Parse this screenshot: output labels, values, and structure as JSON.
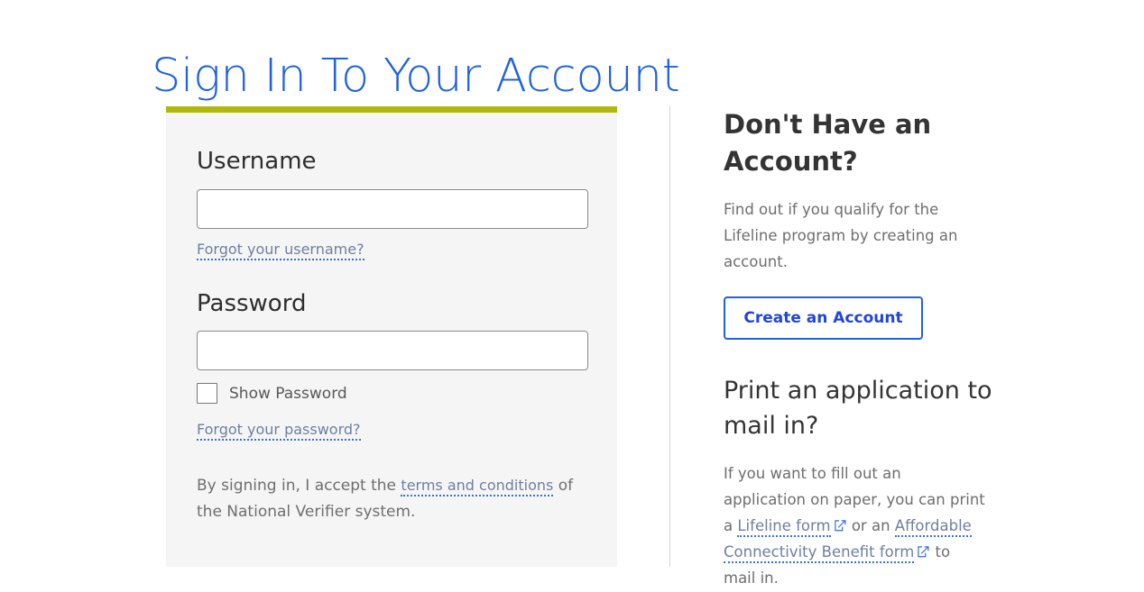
{
  "page": {
    "title": "Sign In To Your Account",
    "accent_blue": "#1F62E0",
    "accent_olive": "#AFB80B",
    "panel_background": "#f5f5f5"
  },
  "signin_form": {
    "username": {
      "label": "Username",
      "value": "",
      "placeholder": "",
      "forgot_link": "Forgot your username?"
    },
    "password": {
      "label": "Password",
      "value": "",
      "placeholder": "",
      "forgot_link": "Forgot your password?",
      "show_password_label": "Show Password",
      "show_password_checked": false
    },
    "terms": {
      "prefix": "By signing in, I accept the ",
      "link": "terms and conditions",
      "suffix": " of the National Verifier system."
    }
  },
  "info_column": {
    "no_account": {
      "heading": "Don't Have an Account?",
      "body": "Find out if you qualify for the Lifeline program by creating an account.",
      "button_label": "Create an Account"
    },
    "print_application": {
      "heading": "Print an application to mail in?",
      "body_part1": "If you want to fill out an application on paper, you can print a ",
      "link1": "Lifeline form",
      "body_part2": " or an ",
      "link2": "Affordable Connectivity Benefit form",
      "body_part3": " to mail in.",
      "external_icon": "external-link-icon"
    }
  }
}
